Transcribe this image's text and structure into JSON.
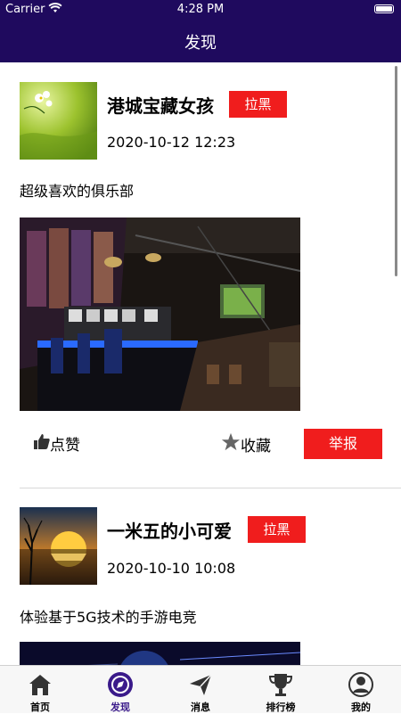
{
  "status_bar": {
    "carrier": "Carrier",
    "time": "4:28 PM"
  },
  "header": {
    "title": "发现"
  },
  "posts": [
    {
      "username": "港城宝藏女孩",
      "block_label": "拉黑",
      "time": "2020-10-12 12:23",
      "content": "超级喜欢的俱乐部",
      "like_label": "点赞",
      "favorite_label": "收藏",
      "report_label": "举报"
    },
    {
      "username": "一米五的小可爱",
      "block_label": "拉黑",
      "time": "2020-10-10 10:08",
      "content": "体验基于5G技术的手游电竞"
    }
  ],
  "tabs": [
    {
      "label": "首页",
      "icon": "home-icon"
    },
    {
      "label": "发现",
      "icon": "compass-icon",
      "active": true
    },
    {
      "label": "消息",
      "icon": "send-icon"
    },
    {
      "label": "排行榜",
      "icon": "trophy-icon"
    },
    {
      "label": "我的",
      "icon": "user-icon"
    }
  ],
  "colors": {
    "header": "#1f0a5e",
    "accent_red": "#f01d1d",
    "active_tab": "#3a1a8a"
  }
}
